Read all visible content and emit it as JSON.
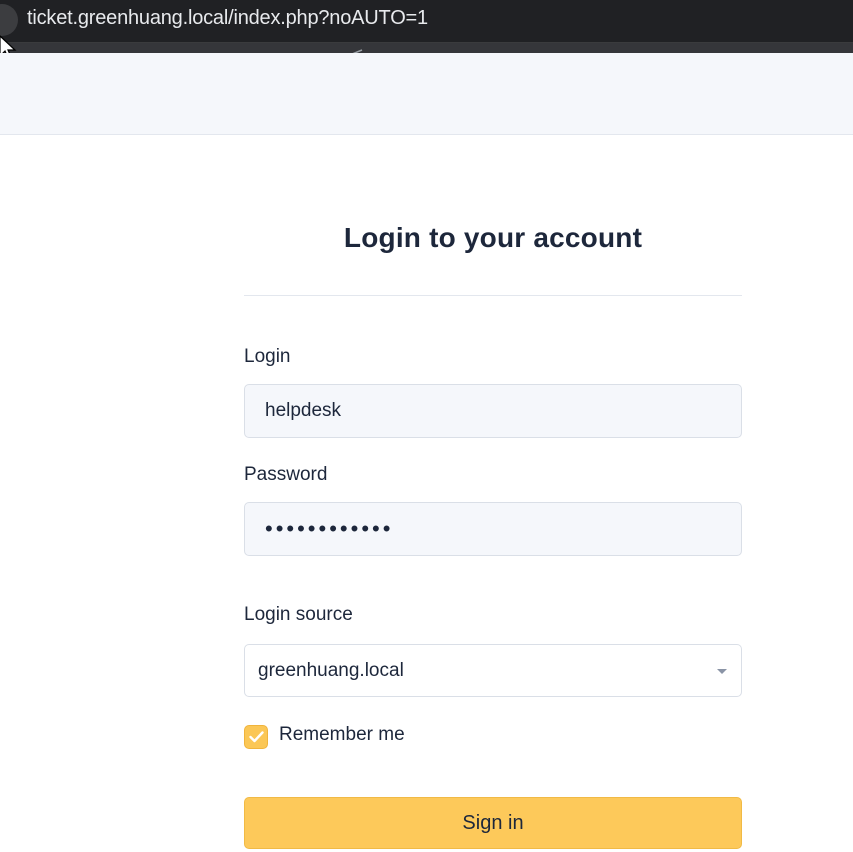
{
  "browser": {
    "url": "ticket.greenhuang.local/index.php?noAUTO=1"
  },
  "login": {
    "title": "Login to your account",
    "login_label": "Login",
    "login_value": "helpdesk",
    "password_label": "Password",
    "password_value": "••••••••••••",
    "source_label": "Login source",
    "source_value": "greenhuang.local",
    "remember_label": "Remember me",
    "remember_checked": true,
    "signin_label": "Sign in"
  },
  "colors": {
    "accent": "#fdc95a",
    "chrome": "#202124",
    "header_bg": "#f5f7fb"
  }
}
